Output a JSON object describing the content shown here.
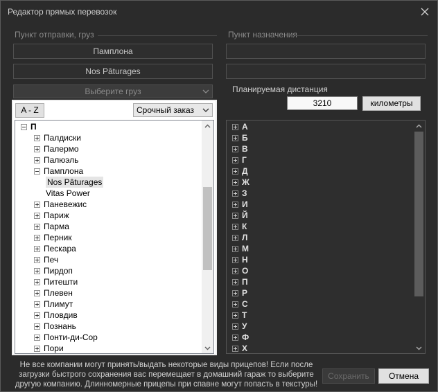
{
  "window": {
    "title": "Редактор прямых перевозок"
  },
  "origin": {
    "group_label": "Пункт отправки, груз",
    "city": "Памплона",
    "company": "Nos Pâturages",
    "cargo_placeholder": "Выберите груз",
    "sort_button": "A - Z",
    "order_type": "Срочный заказ",
    "tree": [
      {
        "label": "П",
        "level": 0,
        "expander": "minus",
        "bold": true
      },
      {
        "label": "Палдиски",
        "level": 1,
        "expander": "plus"
      },
      {
        "label": "Палермо",
        "level": 1,
        "expander": "plus"
      },
      {
        "label": "Палюэль",
        "level": 1,
        "expander": "plus"
      },
      {
        "label": "Памплона",
        "level": 1,
        "expander": "minus"
      },
      {
        "label": "Nos Pâturages",
        "level": 2,
        "expander": "none",
        "selected": true
      },
      {
        "label": "Vitas Power",
        "level": 2,
        "expander": "none"
      },
      {
        "label": "Паневежис",
        "level": 1,
        "expander": "plus"
      },
      {
        "label": "Париж",
        "level": 1,
        "expander": "plus"
      },
      {
        "label": "Парма",
        "level": 1,
        "expander": "plus"
      },
      {
        "label": "Перник",
        "level": 1,
        "expander": "plus"
      },
      {
        "label": "Пескара",
        "level": 1,
        "expander": "plus"
      },
      {
        "label": "Печ",
        "level": 1,
        "expander": "plus"
      },
      {
        "label": "Пирдоп",
        "level": 1,
        "expander": "plus"
      },
      {
        "label": "Питешти",
        "level": 1,
        "expander": "plus"
      },
      {
        "label": "Плевен",
        "level": 1,
        "expander": "plus"
      },
      {
        "label": "Плимут",
        "level": 1,
        "expander": "plus"
      },
      {
        "label": "Пловдив",
        "level": 1,
        "expander": "plus"
      },
      {
        "label": "Познань",
        "level": 1,
        "expander": "plus"
      },
      {
        "label": "Понти-ди-Сор",
        "level": 1,
        "expander": "plus"
      },
      {
        "label": "Пори",
        "level": 1,
        "expander": "plus"
      }
    ]
  },
  "destination": {
    "group_label": "Пункт назначения",
    "city": "",
    "company": "",
    "distance_label": "Планируемая дистанция",
    "distance_value": "3210",
    "units_button": "километры",
    "tree": [
      {
        "label": "А"
      },
      {
        "label": "Б"
      },
      {
        "label": "В"
      },
      {
        "label": "Г"
      },
      {
        "label": "Д"
      },
      {
        "label": "Ж"
      },
      {
        "label": "З"
      },
      {
        "label": "И"
      },
      {
        "label": "Й"
      },
      {
        "label": "К"
      },
      {
        "label": "Л"
      },
      {
        "label": "М"
      },
      {
        "label": "Н"
      },
      {
        "label": "О"
      },
      {
        "label": "П"
      },
      {
        "label": "Р"
      },
      {
        "label": "С"
      },
      {
        "label": "Т"
      },
      {
        "label": "У"
      },
      {
        "label": "Ф"
      },
      {
        "label": "Х"
      }
    ]
  },
  "footer": {
    "notice": "Не все компании могут принять/выдать некоторые виды прицепов! Если после загрузки быстрого сохранения вас перемещает в домашний гараж то выберите другую компанию. Длинномерные прицепы при спавне могут попасть в текстуры!",
    "save_label": "Сохранить",
    "cancel_label": "Отмена"
  }
}
